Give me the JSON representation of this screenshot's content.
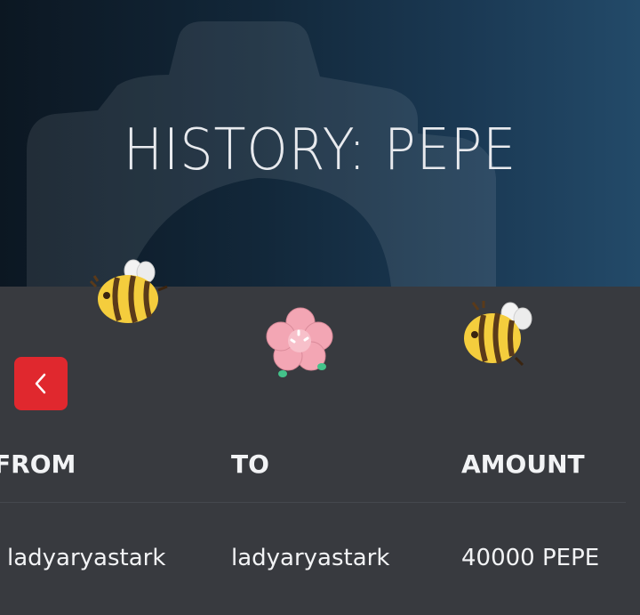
{
  "header": {
    "title": "HISTORY: PEPE"
  },
  "nav": {
    "back_icon": "chevron-left-icon"
  },
  "decorations": [
    "bee-icon",
    "flower-icon",
    "bee-icon"
  ],
  "table": {
    "columns": [
      "FROM",
      "TO",
      "AMOUNT"
    ],
    "rows": [
      {
        "from": "ladyaryastark",
        "to": "ladyaryastark",
        "amount": "40000 PEPE"
      }
    ]
  },
  "colors": {
    "accent": "#e0282e",
    "background": "#383a3f",
    "header_gradient_end": "#234a69"
  }
}
